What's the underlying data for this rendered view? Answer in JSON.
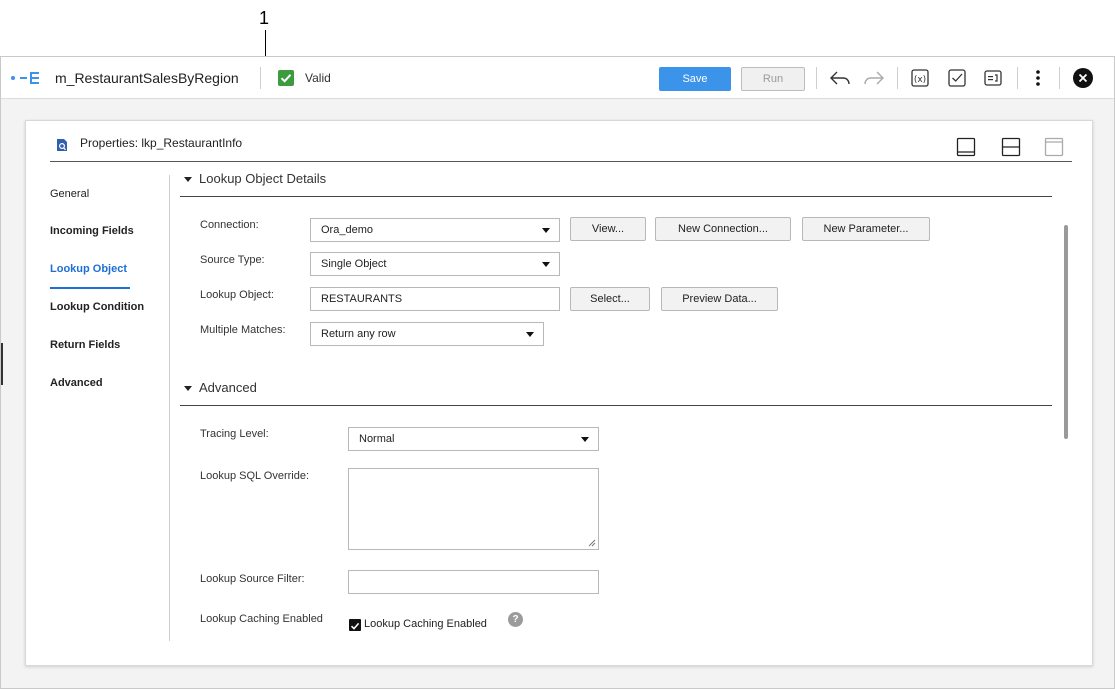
{
  "callout": {
    "number": "1"
  },
  "header": {
    "mapping_name": "m_RestaurantSalesByRegion",
    "status_label": "Valid",
    "save_label": "Save",
    "run_label": "Run",
    "icons": [
      "mapping-icon",
      "valid-check-icon",
      "undo-icon",
      "redo-icon",
      "expression-icon",
      "validate-icon",
      "parameters-icon",
      "more-vertical-icon",
      "close-icon"
    ]
  },
  "panel": {
    "title": "Properties: lkp_RestaurantInfo",
    "layout_icons": [
      "dock-bottom-icon",
      "split-horizontal-icon",
      "maximize-icon"
    ]
  },
  "nav": {
    "items": [
      {
        "label": "General"
      },
      {
        "label": "Incoming Fields"
      },
      {
        "label": "Lookup Object",
        "active": true
      },
      {
        "label": "Lookup Condition"
      },
      {
        "label": "Return Fields"
      },
      {
        "label": "Advanced"
      }
    ]
  },
  "lookup_section": {
    "title": "Lookup Object Details",
    "connection_label": "Connection:",
    "connection_value": "Ora_demo",
    "view_btn": "View...",
    "new_connection_btn": "New Connection...",
    "new_parameter_btn": "New Parameter...",
    "source_type_label": "Source Type:",
    "source_type_value": "Single Object",
    "lookup_object_label": "Lookup Object:",
    "lookup_object_value": "RESTAURANTS",
    "select_btn": "Select...",
    "preview_btn": "Preview Data...",
    "multiple_matches_label": "Multiple Matches:",
    "multiple_matches_value": "Return any row"
  },
  "advanced_section": {
    "title": "Advanced",
    "tracing_level_label": "Tracing Level:",
    "tracing_level_value": "Normal",
    "sql_override_label": "Lookup SQL Override:",
    "sql_override_value": "",
    "source_filter_label": "Lookup Source Filter:",
    "source_filter_value": "",
    "caching_label": "Lookup Caching Enabled",
    "caching_checkbox_label": "Lookup Caching Enabled",
    "caching_checked": true,
    "help_glyph": "?"
  },
  "colors": {
    "accent": "#3b93ea",
    "valid": "#3c9b3c",
    "active_nav": "#1d6fd6"
  }
}
